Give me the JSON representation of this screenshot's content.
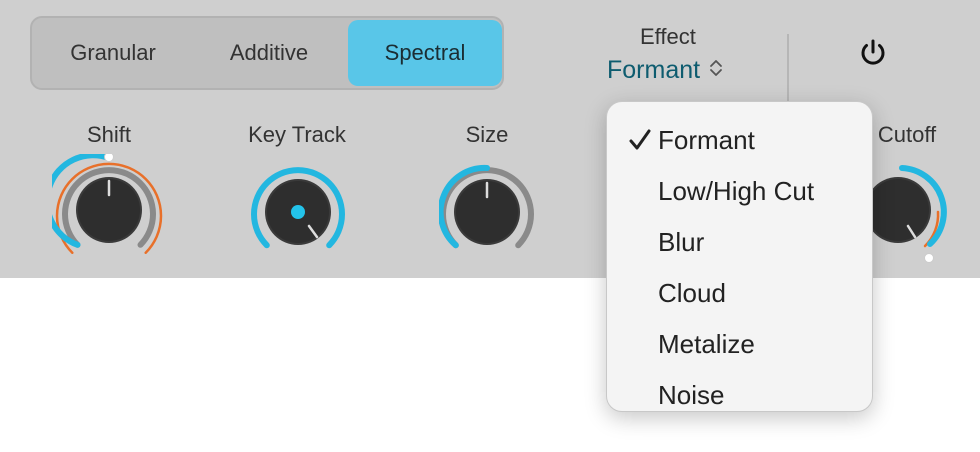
{
  "modes": {
    "items": [
      {
        "label": "Granular"
      },
      {
        "label": "Additive"
      },
      {
        "label": "Spectral"
      }
    ],
    "selected": "Spectral"
  },
  "effect": {
    "title": "Effect",
    "value": "Formant"
  },
  "knobs": [
    {
      "label": "Shift"
    },
    {
      "label": "Key Track"
    },
    {
      "label": "Size"
    },
    {
      "label": "Cutoff"
    }
  ],
  "menu": {
    "items": [
      {
        "label": "Formant",
        "checked": true
      },
      {
        "label": "Low/High Cut",
        "checked": false
      },
      {
        "label": "Blur",
        "checked": false
      },
      {
        "label": "Cloud",
        "checked": false
      },
      {
        "label": "Metalize",
        "checked": false
      },
      {
        "label": "Noise",
        "checked": false
      }
    ]
  },
  "colors": {
    "accent_blue": "#23b7e0",
    "accent_orange": "#e8702a",
    "panel_bg": "#cfcfcf",
    "selected_segment": "#59c6e8",
    "value_text": "#0e5c6f"
  }
}
